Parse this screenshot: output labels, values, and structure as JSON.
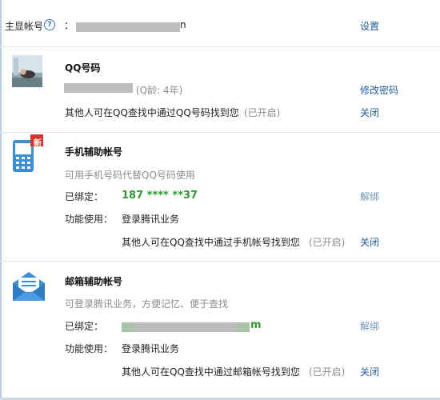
{
  "main_account": {
    "label": "主显帐号",
    "separator": "：",
    "account_tail": "n",
    "settings_link": "设置"
  },
  "qq_section": {
    "title": "QQ号码",
    "age_text": "(Q龄: 4年)",
    "change_password_link": "修改密码",
    "findable_text": "其他人可在QQ查找中通过QQ号码找到您",
    "findable_status": "(已开启)",
    "close_link": "关闭"
  },
  "phone_section": {
    "title": "手机辅助帐号",
    "badge": "新",
    "subtitle": "可用手机号码代替QQ号码使用",
    "bound_label": "已绑定：",
    "bound_value": "187 **** **37",
    "unbind_link": "解绑",
    "function_label": "功能使用：",
    "function_value": "登录腾讯业务",
    "findable_text": "其他人可在QQ查找中通过手机帐号找到您",
    "findable_status": "(已开启)",
    "close_link": "关闭"
  },
  "email_section": {
    "title": "邮箱辅助帐号",
    "subtitle": "可登录腾讯业务，方便记忆、便于查找",
    "bound_label": "已绑定：",
    "bound_value_tail": "m",
    "unbind_link": "解绑",
    "function_label": "功能使用：",
    "function_value": "登录腾讯业务",
    "findable_text": "其他人可在QQ查找中通过邮箱帐号找到您",
    "findable_status": "(已开启)",
    "close_link": "关闭"
  },
  "icons": {
    "help": "question-circle-icon",
    "avatar": "user-avatar",
    "phone": "mobile-phone-icon",
    "email": "envelope-icon"
  },
  "colors": {
    "link": "#1d5b9a",
    "bound_value": "#2f9b2f",
    "badge": "#d9342b",
    "icon_blue": "#3b8ed8"
  }
}
